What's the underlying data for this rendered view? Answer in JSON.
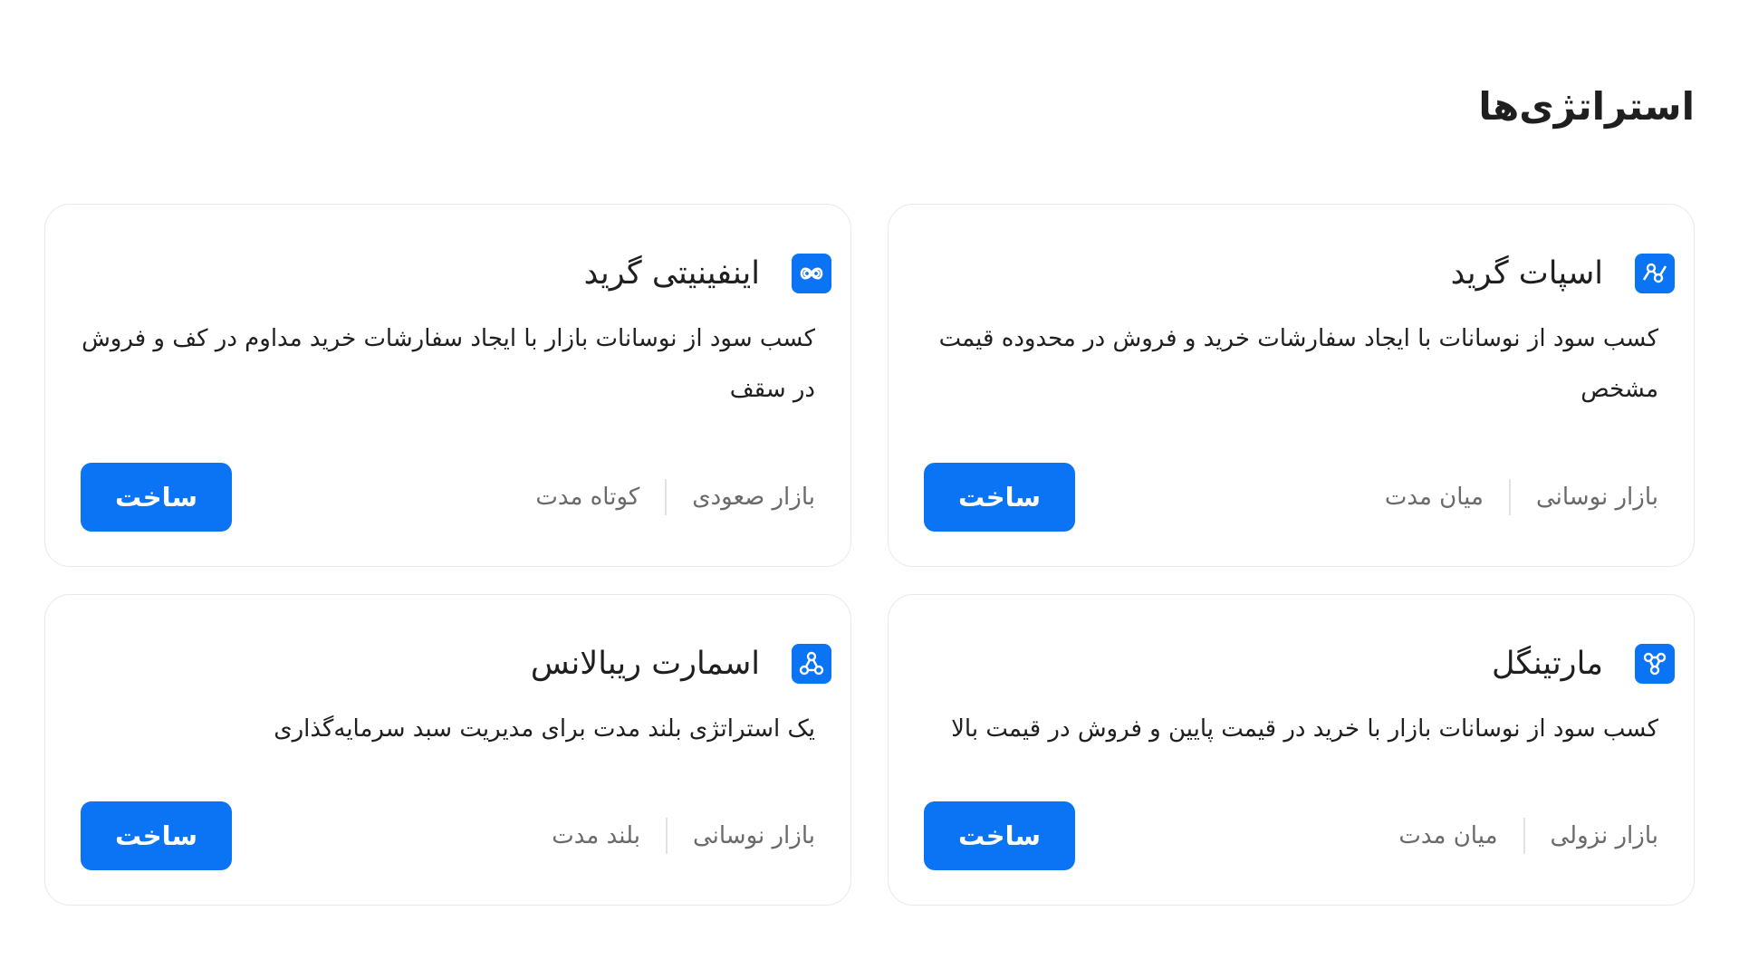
{
  "page": {
    "title": "استراتژی‌ها"
  },
  "colors": {
    "accent": "#0a74f5",
    "text": "#1f1f1f",
    "muted": "#6a6a6a",
    "border": "#e8e8e8"
  },
  "cards": [
    {
      "icon": "spot-grid-icon",
      "title": "اسپات گرید",
      "description": "کسب سود از نوسانات با ایجاد سفارشات خرید و فروش در محدوده قیمت مشخص",
      "tag_market": "بازار نوسانی",
      "tag_term": "میان مدت",
      "button_label": "ساخت"
    },
    {
      "icon": "infinity-grid-icon",
      "title": "اینفینیتی گرید",
      "description": "کسب سود از نوسانات بازار با ایجاد سفارشات خرید مداوم در کف و فروش در سقف",
      "tag_market": "بازار صعودی",
      "tag_term": "کوتاه مدت",
      "button_label": "ساخت"
    },
    {
      "icon": "martingale-icon",
      "title": "مارتینگل",
      "description": "کسب سود از نوسانات بازار با خرید در قیمت پایین و فروش در قیمت بالا",
      "tag_market": "بازار نزولی",
      "tag_term": "میان مدت",
      "button_label": "ساخت"
    },
    {
      "icon": "smart-rebalance-icon",
      "title": "اسمارت ریبالانس",
      "description": "یک استراتژی بلند مدت برای مدیریت سبد سرمایه‌گذاری",
      "tag_market": "بازار نوسانی",
      "tag_term": "بلند مدت",
      "button_label": "ساخت"
    }
  ]
}
